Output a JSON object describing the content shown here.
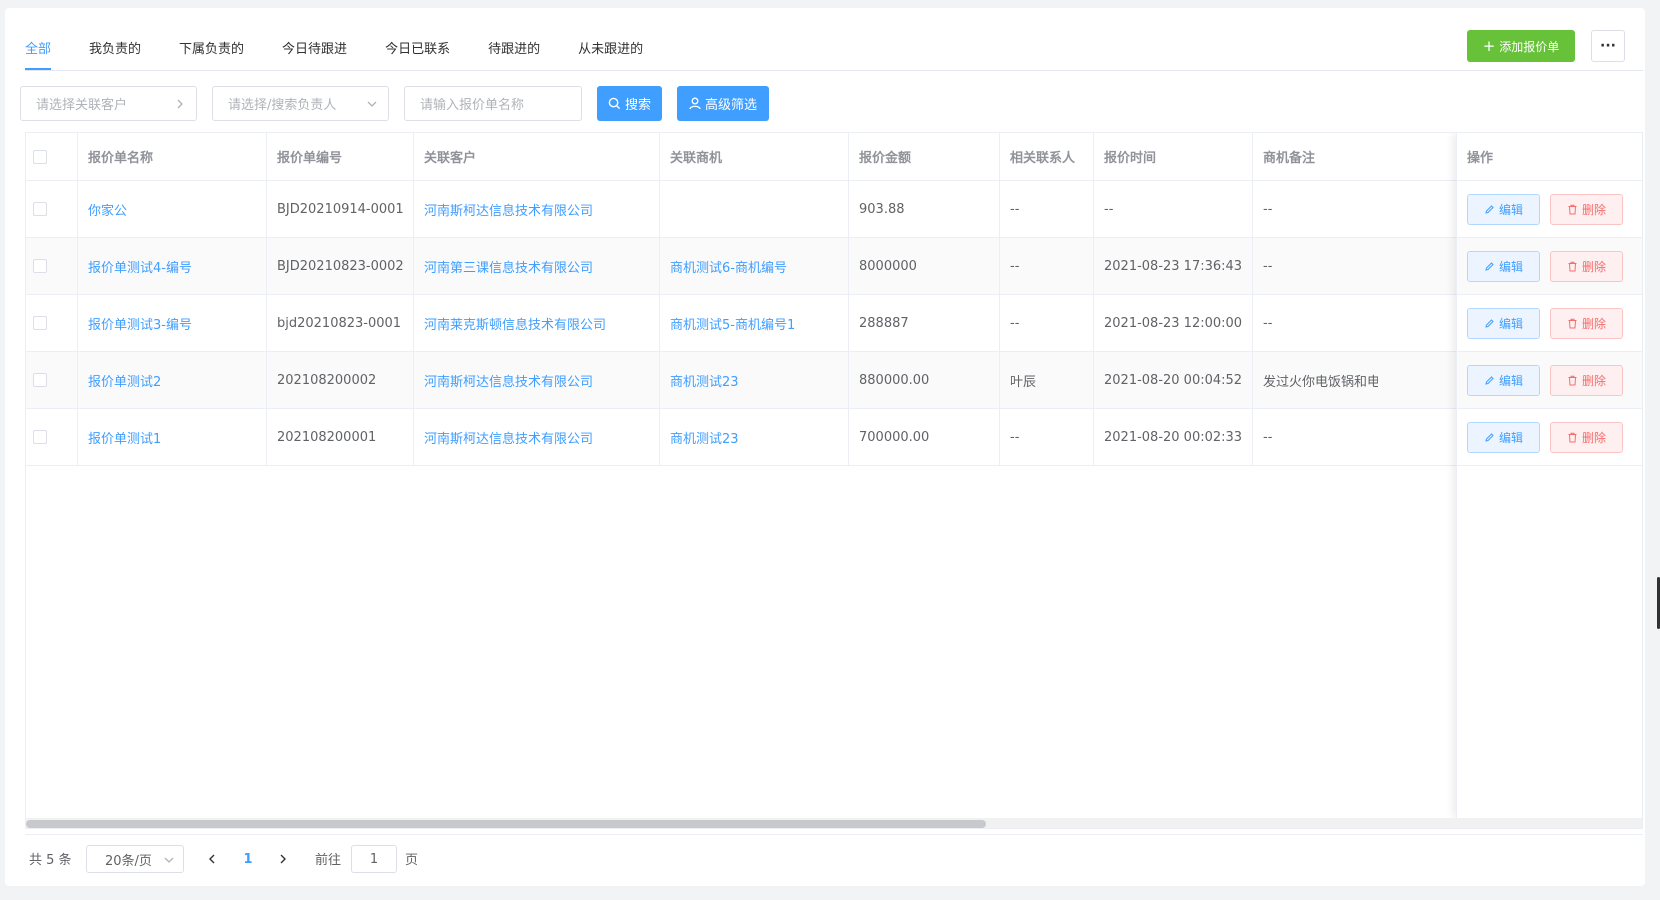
{
  "tabs": [
    {
      "label": "全部",
      "active": true
    },
    {
      "label": "我负责的",
      "active": false
    },
    {
      "label": "下属负责的",
      "active": false
    },
    {
      "label": "今日待跟进",
      "active": false
    },
    {
      "label": "今日已联系",
      "active": false
    },
    {
      "label": "待跟进的",
      "active": false
    },
    {
      "label": "从未跟进的",
      "active": false
    }
  ],
  "toolbar": {
    "add_label": "添加报价单",
    "more_label": "···"
  },
  "filters": {
    "customer_placeholder": "请选择关联客户",
    "owner_placeholder": "请选择/搜索负责人",
    "name_placeholder": "请输入报价单名称",
    "search_label": "搜索",
    "advanced_label": "高级筛选"
  },
  "table": {
    "columns": [
      "报价单名称",
      "报价单编号",
      "关联客户",
      "关联商机",
      "报价金额",
      "相关联系人",
      "报价时间",
      "商机备注",
      "操作"
    ],
    "rows": [
      {
        "name": "你家公",
        "code": "BJD20210914-0001",
        "customer": "河南斯柯达信息技术有限公司",
        "opportunity": "",
        "amount": "903.88",
        "contact": "--",
        "time": "--",
        "remark": "--"
      },
      {
        "name": "报价单测试4-编号",
        "code": "BJD20210823-0002",
        "customer": "河南第三课信息技术有限公司",
        "opportunity": "商机测试6-商机编号",
        "amount": "8000000",
        "contact": "--",
        "time": "2021-08-23 17:36:43",
        "remark": "--"
      },
      {
        "name": "报价单测试3-编号",
        "code": "bjd20210823-0001",
        "customer": "河南莱克斯顿信息技术有限公司",
        "opportunity": "商机测试5-商机编号1",
        "amount": "288887",
        "contact": "--",
        "time": "2021-08-23 12:00:00",
        "remark": "--"
      },
      {
        "name": "报价单测试2",
        "code": "202108200002",
        "customer": "河南斯柯达信息技术有限公司",
        "opportunity": "商机测试23",
        "amount": "880000.00",
        "contact": "叶辰",
        "time": "2021-08-20 00:04:52",
        "remark": "发过火你电饭锅和电"
      },
      {
        "name": "报价单测试1",
        "code": "202108200001",
        "customer": "河南斯柯达信息技术有限公司",
        "opportunity": "商机测试23",
        "amount": "700000.00",
        "contact": "--",
        "time": "2021-08-20 00:02:33",
        "remark": "--"
      }
    ],
    "edit_label": "编辑",
    "delete_label": "删除"
  },
  "pagination": {
    "total_text": "共 5 条",
    "page_size": "20条/页",
    "current_page": "1",
    "goto_label": "前往",
    "goto_value": "1",
    "page_suffix": "页"
  },
  "colors": {
    "primary": "#409eff",
    "success": "#67c23a",
    "danger": "#f56c6c"
  }
}
